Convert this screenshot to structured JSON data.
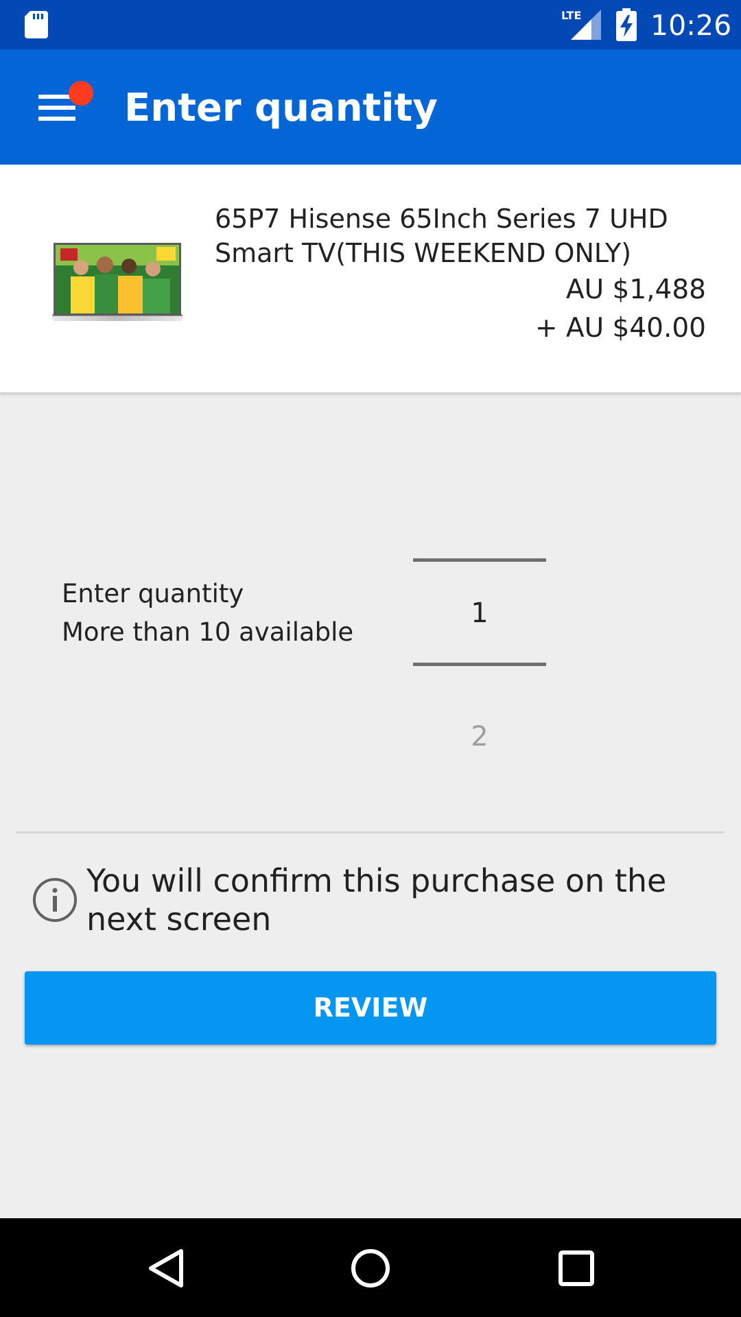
{
  "status_bar": {
    "time": "10:26",
    "network_label": "LTE",
    "icons": [
      "sd-card-icon",
      "lte-signal-icon",
      "battery-charging-icon"
    ]
  },
  "app_bar": {
    "title": "Enter quantity",
    "menu_icon": "hamburger-menu-icon",
    "notification_dot_color": "#ff3b1f"
  },
  "product": {
    "title": "65P7 Hisense 65Inch Series 7 UHD Smart TV(THIS WEEKEND ONLY)",
    "price": "AU $1,488",
    "shipping": "+ AU $40.00",
    "image_icon": "tv-product-thumbnail"
  },
  "quantity": {
    "label": "Enter quantity",
    "availability": "More than 10 available",
    "selected_value": "1",
    "next_value": "2"
  },
  "info": {
    "icon": "info-icon",
    "text": "You will confirm this purchase on the next screen"
  },
  "actions": {
    "review_label": "REVIEW"
  },
  "nav_bar": {
    "icons": [
      "back-icon",
      "home-icon",
      "recents-icon"
    ]
  },
  "colors": {
    "status_bar": "#0349b6",
    "app_bar": "#0366d6",
    "button": "#0496f0",
    "background": "#eeeeee"
  }
}
